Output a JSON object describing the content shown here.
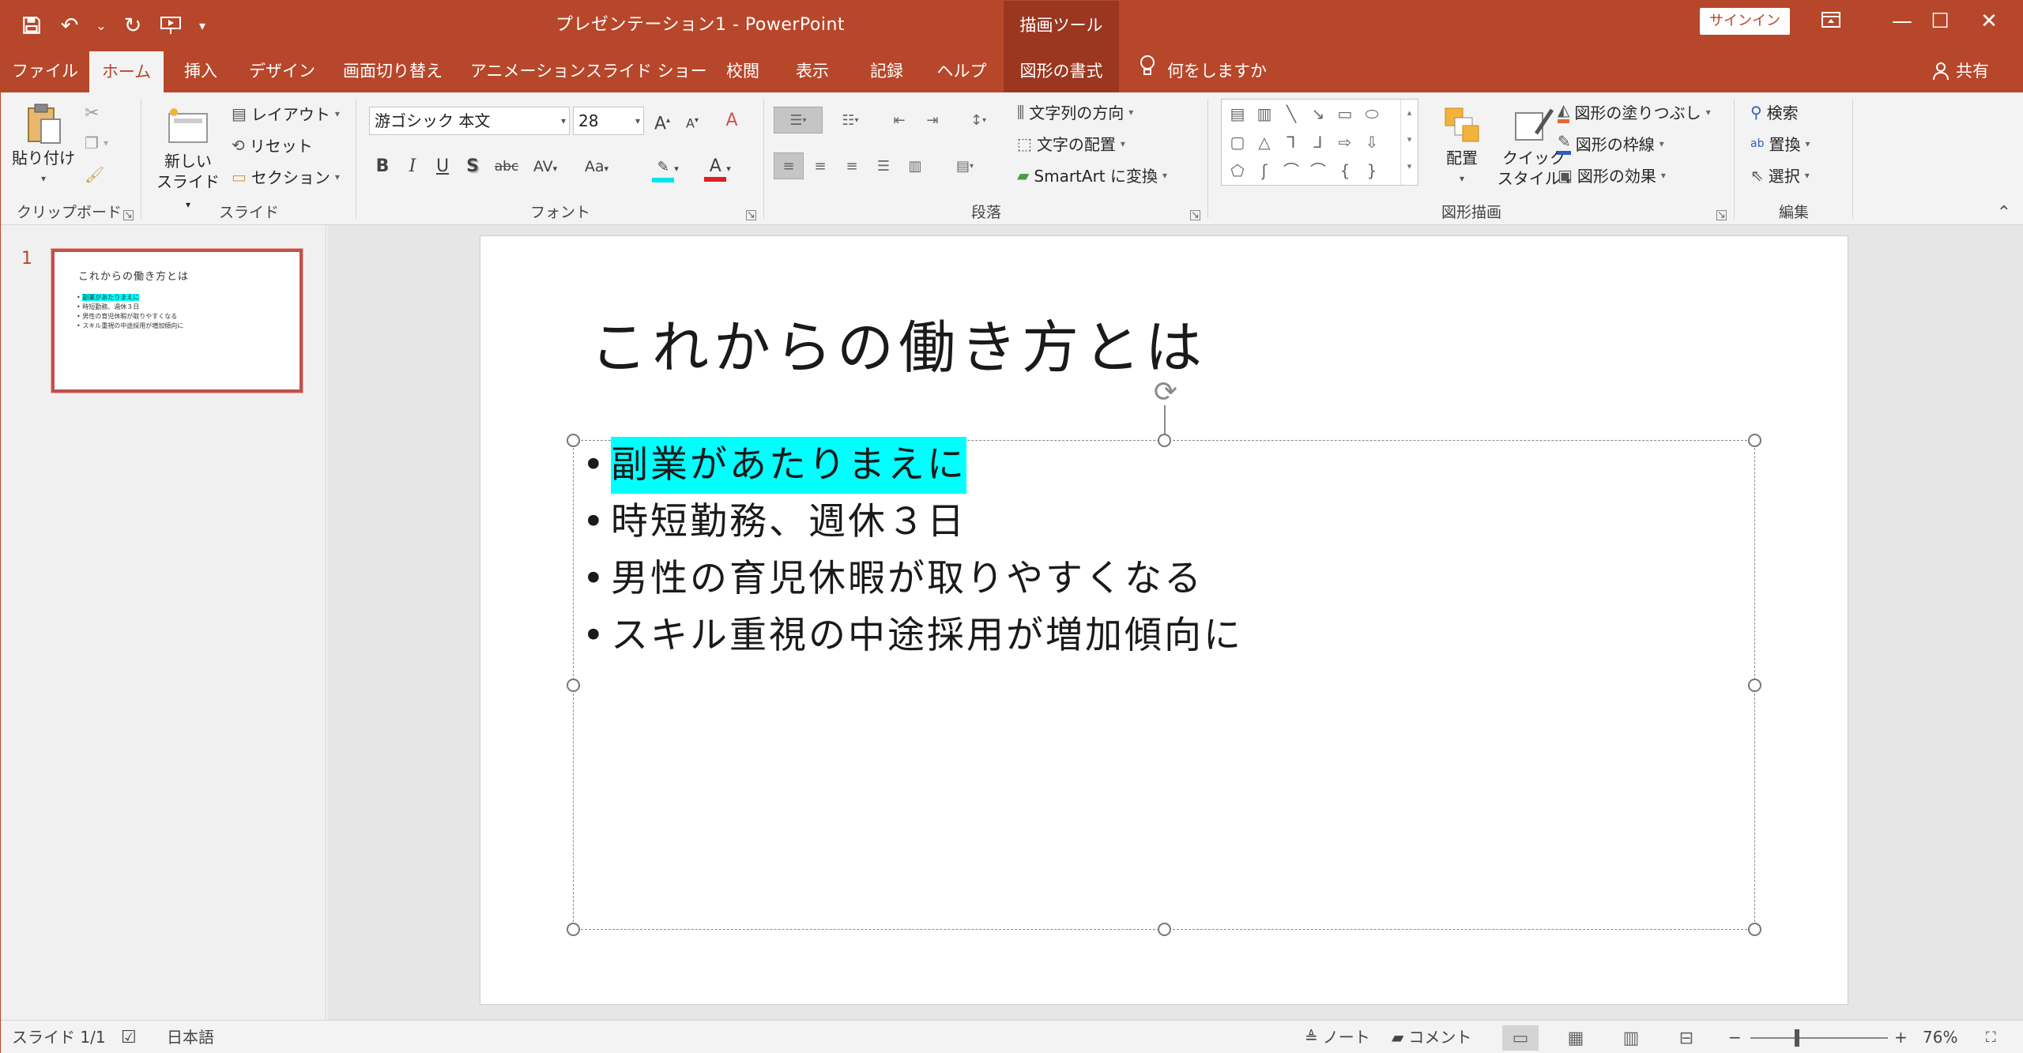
{
  "app": {
    "title": "プレゼンテーション1 - PowerPoint",
    "context_tab_group": "描画ツール",
    "signin_label": "サインイン",
    "accent": "#b7472a",
    "highlight": "#00ffff"
  },
  "qat": {
    "save_icon": "save-icon",
    "undo_icon": "undo-icon",
    "redo_icon": "redo-icon",
    "present_icon": "present-from-start-icon",
    "customize_icon": "customize-qat-icon"
  },
  "window_controls": {
    "ribbon_display": "ribbon-display-options-icon",
    "minimize": "minimize-icon",
    "maximize": "maximize-icon",
    "close": "close-icon"
  },
  "tabs": [
    {
      "label": "ファイル"
    },
    {
      "label": "ホーム"
    },
    {
      "label": "挿入"
    },
    {
      "label": "デザイン"
    },
    {
      "label": "画面切り替え"
    },
    {
      "label": "アニメーション"
    },
    {
      "label": "スライド ショー"
    },
    {
      "label": "校閲"
    },
    {
      "label": "表示"
    },
    {
      "label": "記録"
    },
    {
      "label": "ヘルプ"
    },
    {
      "label": "図形の書式"
    }
  ],
  "tell_me": "何をしますか",
  "share": "共有",
  "ribbon": {
    "clipboard": {
      "paste": "貼り付け",
      "group": "クリップボード"
    },
    "slides": {
      "new_slide_l1": "新しい",
      "new_slide_l2": "スライド",
      "layout": "レイアウト",
      "reset": "リセット",
      "section": "セクション",
      "group": "スライド"
    },
    "font": {
      "font_name": "游ゴシック 本文",
      "font_size": "28",
      "grow": "A",
      "shrink": "A",
      "bold": "B",
      "italic": "I",
      "underline": "U",
      "shadow": "S",
      "strike": "abc",
      "spacing": "AV",
      "case": "Aa",
      "font_color": "A",
      "group": "フォント"
    },
    "paragraph": {
      "text_direction": "文字列の方向",
      "align_text": "文字の配置",
      "smartart": "SmartArt に変換",
      "group": "段落"
    },
    "drawing": {
      "arrange": "配置",
      "quick_styles_l1": "クイック",
      "quick_styles_l2": "スタイル",
      "shape_fill": "図形の塗りつぶし",
      "shape_outline": "図形の枠線",
      "shape_effects": "図形の効果",
      "group": "図形描画"
    },
    "editing": {
      "find": "検索",
      "replace": "置換",
      "select": "選択",
      "group": "編集"
    }
  },
  "thumbnails": [
    {
      "number": "1",
      "title": "これからの働き方とは",
      "bullets": [
        "副業があたりまえに",
        "時短勤務、週休３日",
        "男性の育児休暇が取りやすくなる",
        "スキル重視の中途採用が増加傾向に"
      ]
    }
  ],
  "slide": {
    "title": "これからの働き方とは",
    "bullets": [
      {
        "text": "副業があたりまえに",
        "highlighted": true
      },
      {
        "text": "時短勤務、週休３日",
        "highlighted": false
      },
      {
        "text": "男性の育児休暇が取りやすくなる",
        "highlighted": false
      },
      {
        "text": "スキル重視の中途採用が増加傾向に",
        "highlighted": false
      }
    ]
  },
  "status": {
    "slide_info": "スライド 1/1",
    "language": "日本語",
    "notes": "ノート",
    "comments": "コメント",
    "zoom": "76%",
    "zoom_out": "−",
    "zoom_in": "+"
  }
}
